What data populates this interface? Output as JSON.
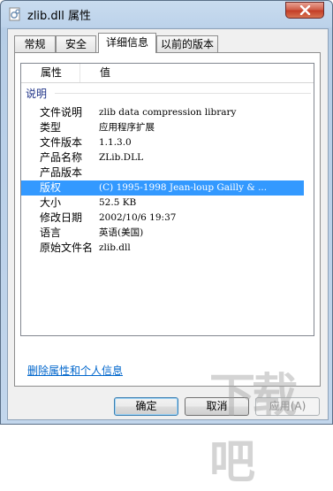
{
  "window": {
    "title": "zlib.dll 属性"
  },
  "tabs": [
    {
      "label": "常规",
      "active": false
    },
    {
      "label": "安全",
      "active": false
    },
    {
      "label": "详细信息",
      "active": true
    },
    {
      "label": "以前的版本",
      "active": false
    }
  ],
  "details": {
    "columns": {
      "property": "属性",
      "value": "值"
    },
    "group_label": "说明",
    "rows": [
      {
        "key": "文件说明",
        "value": "zlib data compression library",
        "selected": false
      },
      {
        "key": "类型",
        "value": "应用程序扩展",
        "selected": false
      },
      {
        "key": "文件版本",
        "value": "1.1.3.0",
        "selected": false
      },
      {
        "key": "产品名称",
        "value": "ZLib.DLL",
        "selected": false
      },
      {
        "key": "产品版本",
        "value": "",
        "selected": false
      },
      {
        "key": "版权",
        "value": "(C) 1995-1998 Jean-loup Gailly & ...",
        "selected": true
      },
      {
        "key": "大小",
        "value": "52.5 KB",
        "selected": false
      },
      {
        "key": "修改日期",
        "value": "2002/10/6 19:37",
        "selected": false
      },
      {
        "key": "语言",
        "value": "英语(美国)",
        "selected": false
      },
      {
        "key": "原始文件名",
        "value": "zlib.dll",
        "selected": false
      }
    ]
  },
  "remove_link": "删除属性和个人信息",
  "buttons": {
    "ok": "确定",
    "cancel": "取消",
    "apply": "应用(A)"
  },
  "watermark": "下载吧",
  "colors": {
    "selection": "#3399ff",
    "link": "#0066cc",
    "group": "#1e3287"
  }
}
